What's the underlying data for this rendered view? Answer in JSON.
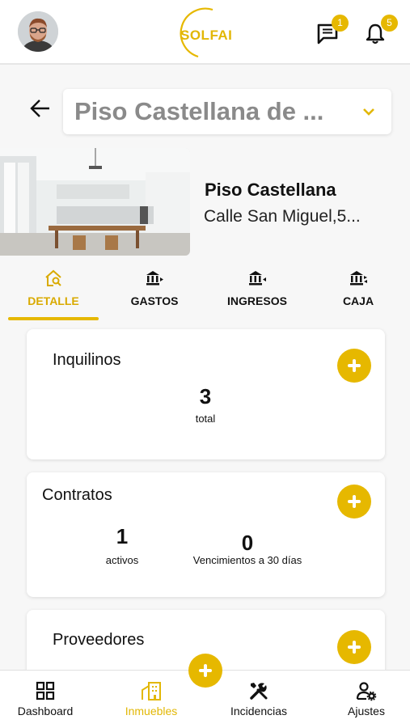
{
  "header": {
    "logo_text": "SOLFAI",
    "messages_badge": "1",
    "notifications_badge": "5",
    "accent_color": "#e6b800"
  },
  "property_selector": {
    "value": "Piso Castellana de ..."
  },
  "property": {
    "name": "Piso Castellana",
    "address": "Calle San Miguel,5..."
  },
  "tabs": [
    {
      "label": "DETALLE",
      "icon": "house-search-icon",
      "active": true
    },
    {
      "label": "GASTOS",
      "icon": "bank-out-icon",
      "active": false
    },
    {
      "label": "INGRESOS",
      "icon": "bank-in-icon",
      "active": false
    },
    {
      "label": "CAJA",
      "icon": "bank-swap-icon",
      "active": false
    }
  ],
  "cards": {
    "inquilinos": {
      "title": "Inquilinos",
      "total_value": "3",
      "total_label": "total"
    },
    "contratos": {
      "title": "Contratos",
      "activos_value": "1",
      "activos_label": "activos",
      "vencimientos_value": "0",
      "vencimientos_label": "Vencimientos a 30 días"
    },
    "proveedores": {
      "title": "Proveedores"
    }
  },
  "bottom_nav": [
    {
      "label": "Dashboard",
      "icon": "grid-icon",
      "active": false
    },
    {
      "label": "Inmuebles",
      "icon": "building-icon",
      "active": true
    },
    {
      "label": "Incidencias",
      "icon": "tools-icon",
      "active": false
    },
    {
      "label": "Ajustes",
      "icon": "user-settings-icon",
      "active": false
    }
  ]
}
